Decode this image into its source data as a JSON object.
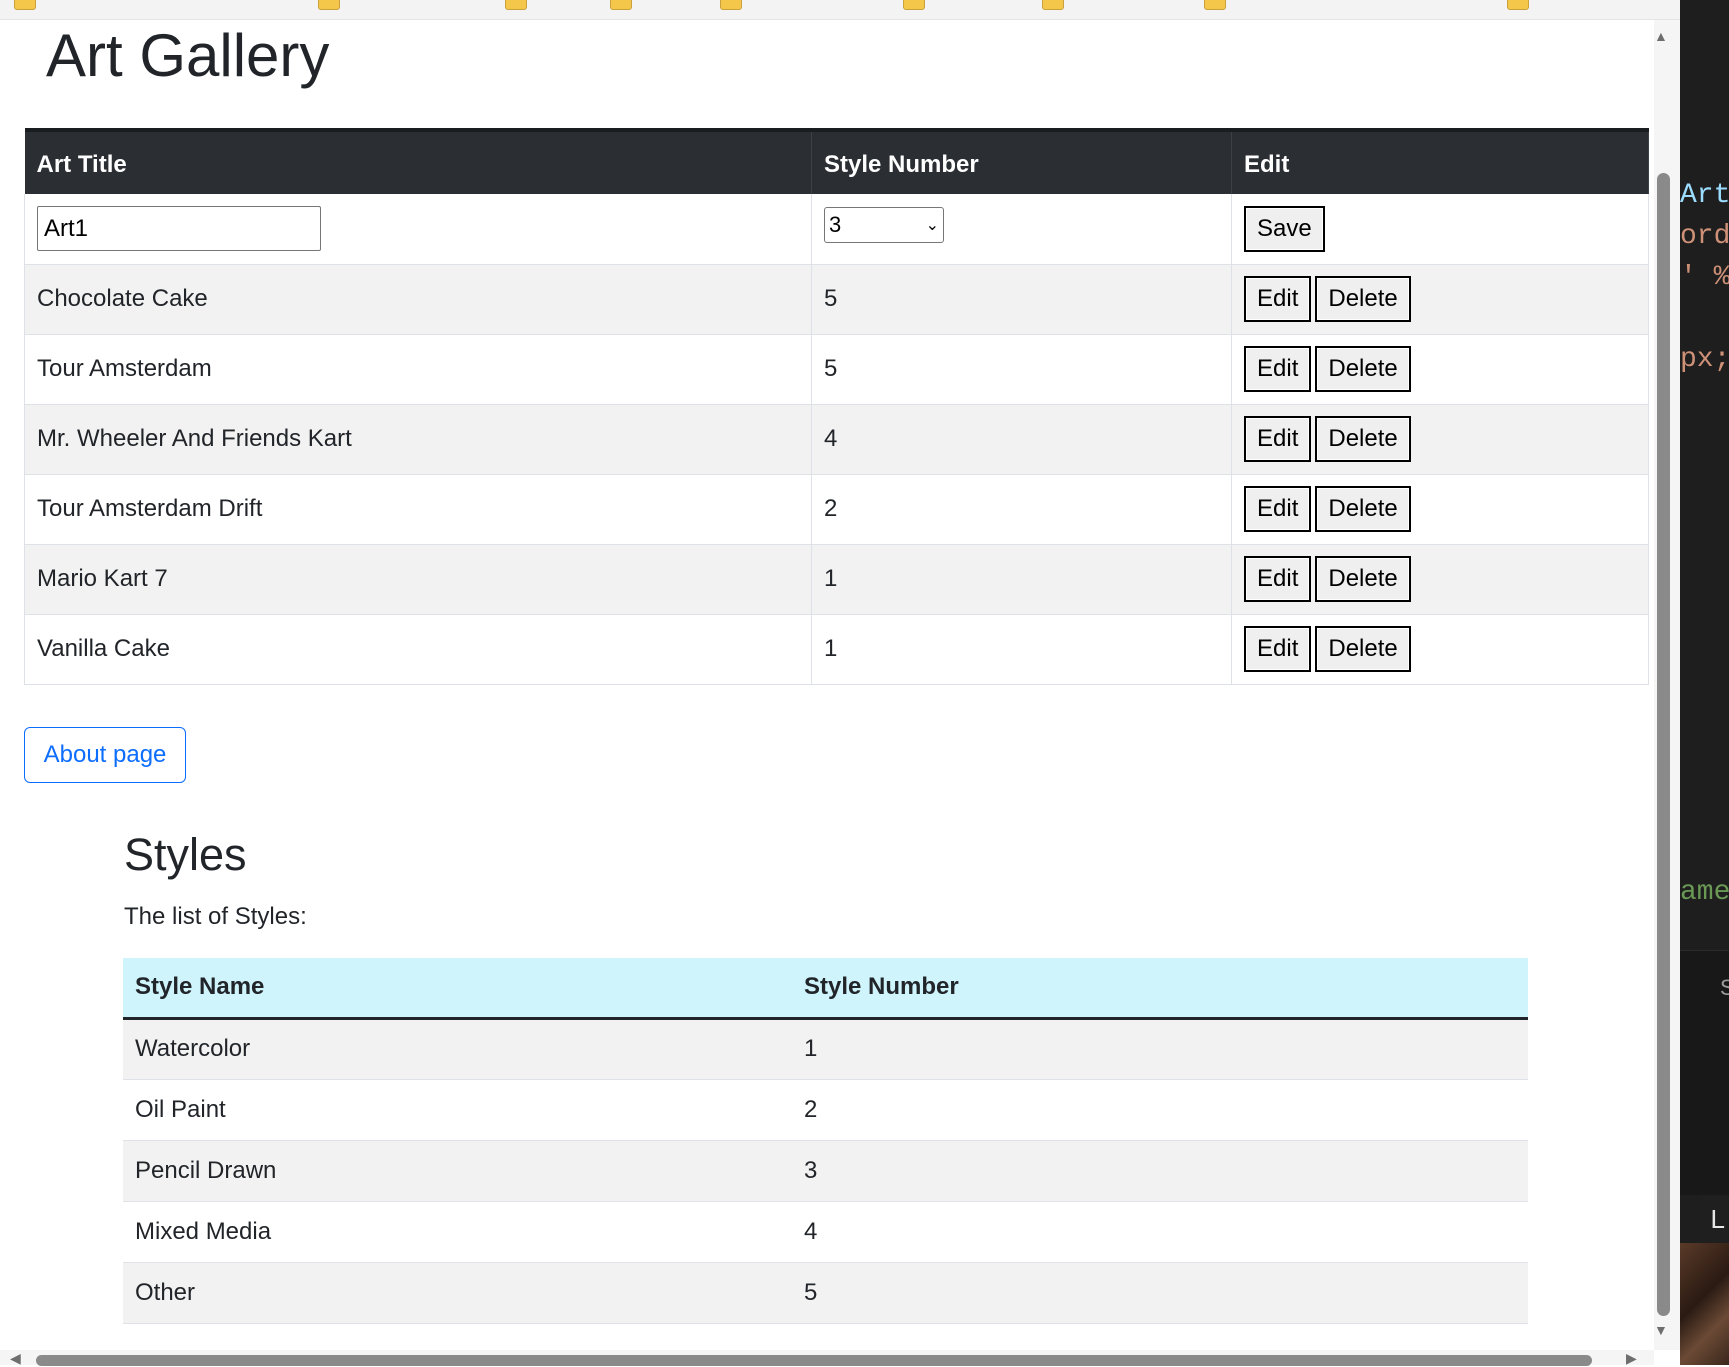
{
  "page": {
    "title": "Art Gallery",
    "about_button": "About page"
  },
  "art_table": {
    "headers": [
      "Art Title",
      "Style Number",
      "Edit"
    ],
    "edit_row": {
      "title_value": "Art1",
      "style_selected": "3",
      "save_label": "Save"
    },
    "rows": [
      {
        "title": "Chocolate Cake",
        "style": "5"
      },
      {
        "title": "Tour Amsterdam",
        "style": "5"
      },
      {
        "title": "Mr. Wheeler And Friends Kart",
        "style": "4"
      },
      {
        "title": "Tour Amsterdam Drift",
        "style": "2"
      },
      {
        "title": "Mario Kart 7",
        "style": "1"
      },
      {
        "title": "Vanilla Cake",
        "style": "1"
      }
    ],
    "edit_label": "Edit",
    "delete_label": "Delete"
  },
  "styles": {
    "title": "Styles",
    "description": "The list of Styles:",
    "headers": [
      "Style Name",
      "Style Number"
    ],
    "rows": [
      {
        "name": "Watercolor",
        "number": "1"
      },
      {
        "name": "Oil Paint",
        "number": "2"
      },
      {
        "name": "Pencil Drawn",
        "number": "3"
      },
      {
        "name": "Mixed Media",
        "number": "4"
      },
      {
        "name": "Other",
        "number": "5"
      }
    ]
  },
  "editor_fragments": {
    "line1": "Art",
    "line2": "ord",
    "line3": "' %",
    "line4": "px;",
    "line5": "ame",
    "panel_letter": "S",
    "status_letter": "L"
  },
  "colors": {
    "table_header_bg": "#2b2f33",
    "styles_header_bg": "#cff4fc",
    "link_blue": "#0d6efd",
    "stripe": "#f2f2f2"
  }
}
